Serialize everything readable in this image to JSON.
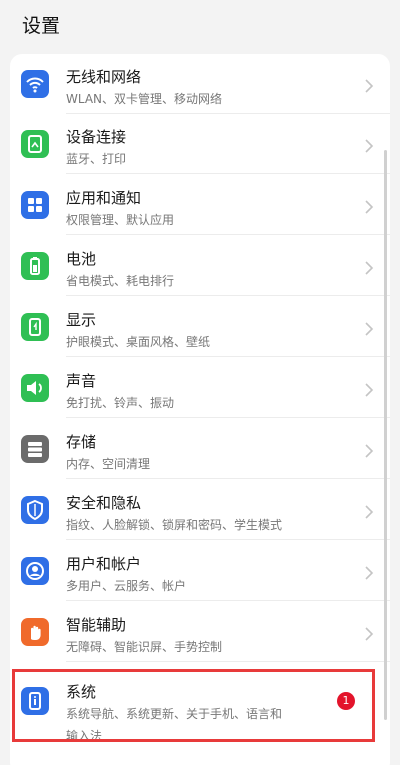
{
  "header": {
    "title": "设置"
  },
  "colors": {
    "accent_blue": "#2b6cf0",
    "accent_green": "#34c35a",
    "accent_gray": "#6b6b6b",
    "accent_orange": "#f06a2b",
    "badge_red": "#e3142b",
    "highlight_red": "#e83a3a"
  },
  "items": [
    {
      "title": "无线和网络",
      "subtitle": "WLAN、双卡管理、移动网络",
      "icon": "wifi-icon",
      "color": "#2f6fe6"
    },
    {
      "title": "设备连接",
      "subtitle": "蓝牙、打印",
      "icon": "device-connection-icon",
      "color": "#2fbf54"
    },
    {
      "title": "应用和通知",
      "subtitle": "权限管理、默认应用",
      "icon": "apps-icon",
      "color": "#2f6fe6"
    },
    {
      "title": "电池",
      "subtitle": "省电模式、耗电排行",
      "icon": "battery-icon",
      "color": "#2fbf54"
    },
    {
      "title": "显示",
      "subtitle": "护眼模式、桌面风格、壁纸",
      "icon": "display-icon",
      "color": "#2fbf54"
    },
    {
      "title": "声音",
      "subtitle": "免打扰、铃声、振动",
      "icon": "sound-icon",
      "color": "#2fbf54"
    },
    {
      "title": "存储",
      "subtitle": "内存、空间清理",
      "icon": "storage-icon",
      "color": "#6b6b6b"
    },
    {
      "title": "安全和隐私",
      "subtitle": "指纹、人脸解锁、锁屏和密码、学生模式",
      "icon": "shield-icon",
      "color": "#2f6fe6"
    },
    {
      "title": "用户和帐户",
      "subtitle": "多用户、云服务、帐户",
      "icon": "user-icon",
      "color": "#2f6fe6"
    },
    {
      "title": "智能辅助",
      "subtitle": "无障碍、智能识屏、手势控制",
      "icon": "hand-icon",
      "color": "#f06a2b"
    }
  ],
  "system": {
    "title": "系统",
    "subtitle_line1": "系统导航、系统更新、关于手机、语言和",
    "subtitle_line2": "输入法",
    "icon": "phone-info-icon",
    "badge": "1"
  }
}
